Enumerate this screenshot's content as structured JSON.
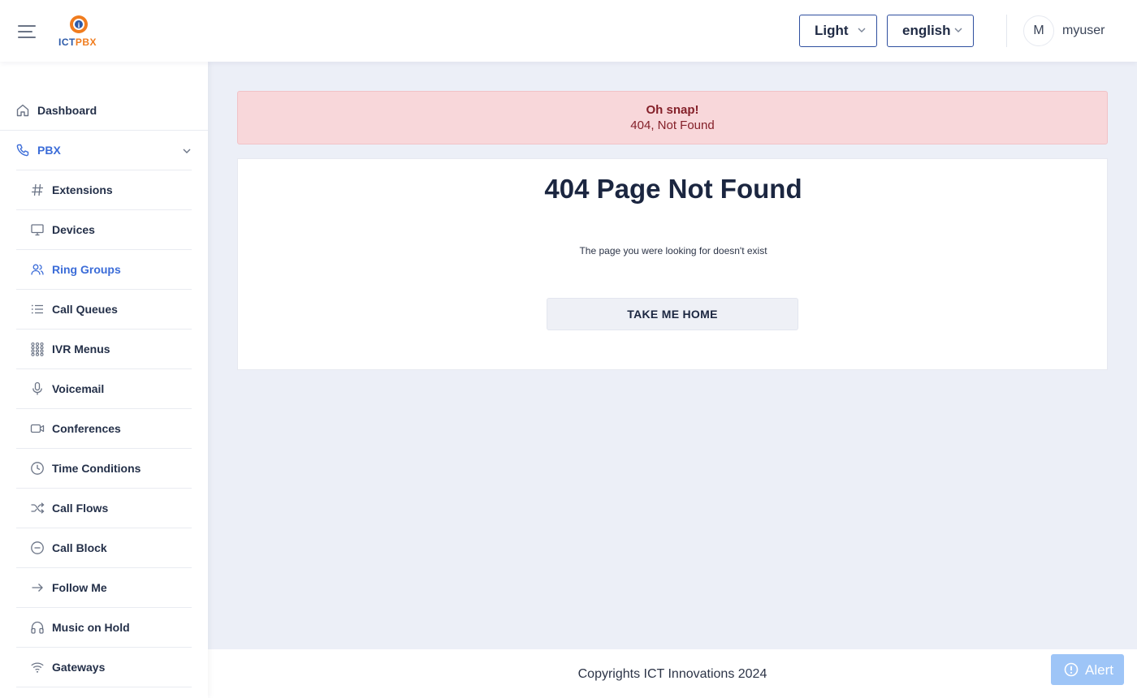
{
  "header": {
    "logo_text_a": "ICT",
    "logo_text_b": "PBX",
    "theme_select": {
      "value": "Light"
    },
    "language_select": {
      "value": "english"
    },
    "user": {
      "initial": "M",
      "name": "myuser"
    }
  },
  "sidebar": {
    "dashboard": {
      "label": "Dashboard",
      "icon": "home-icon"
    },
    "pbx": {
      "label": "PBX",
      "icon": "phone-icon",
      "expanded": true
    },
    "items": [
      {
        "label": "Extensions",
        "icon": "hash-icon"
      },
      {
        "label": "Devices",
        "icon": "monitor-icon"
      },
      {
        "label": "Ring Groups",
        "icon": "users-icon",
        "active": true
      },
      {
        "label": "Call Queues",
        "icon": "list-icon"
      },
      {
        "label": "IVR Menus",
        "icon": "grid-icon"
      },
      {
        "label": "Voicemail",
        "icon": "microphone-icon"
      },
      {
        "label": "Conferences",
        "icon": "video-icon"
      },
      {
        "label": "Time Conditions",
        "icon": "clock-icon"
      },
      {
        "label": "Call Flows",
        "icon": "shuffle-icon"
      },
      {
        "label": "Call Block",
        "icon": "minus-circle-icon"
      },
      {
        "label": "Follow Me",
        "icon": "arrow-right-icon"
      },
      {
        "label": "Music on Hold",
        "icon": "headphones-icon"
      },
      {
        "label": "Gateways",
        "icon": "wifi-icon"
      }
    ]
  },
  "alert": {
    "title": "Oh snap!",
    "message": "404, Not Found"
  },
  "error_card": {
    "title": "404 Page Not Found",
    "subtitle": "The page you were looking for doesn't exist",
    "button_label": "TAKE ME HOME"
  },
  "footer": {
    "copyright": "Copyrights ICT Innovations 2024"
  },
  "floating_alert": {
    "label": "Alert",
    "icon": "alert-circle-icon"
  },
  "colors": {
    "accent": "#3b6cd8",
    "danger_bg": "#f8d7da",
    "danger_text": "#842029",
    "page_bg": "#eceff7",
    "alert_button": "#9ec5f7"
  }
}
